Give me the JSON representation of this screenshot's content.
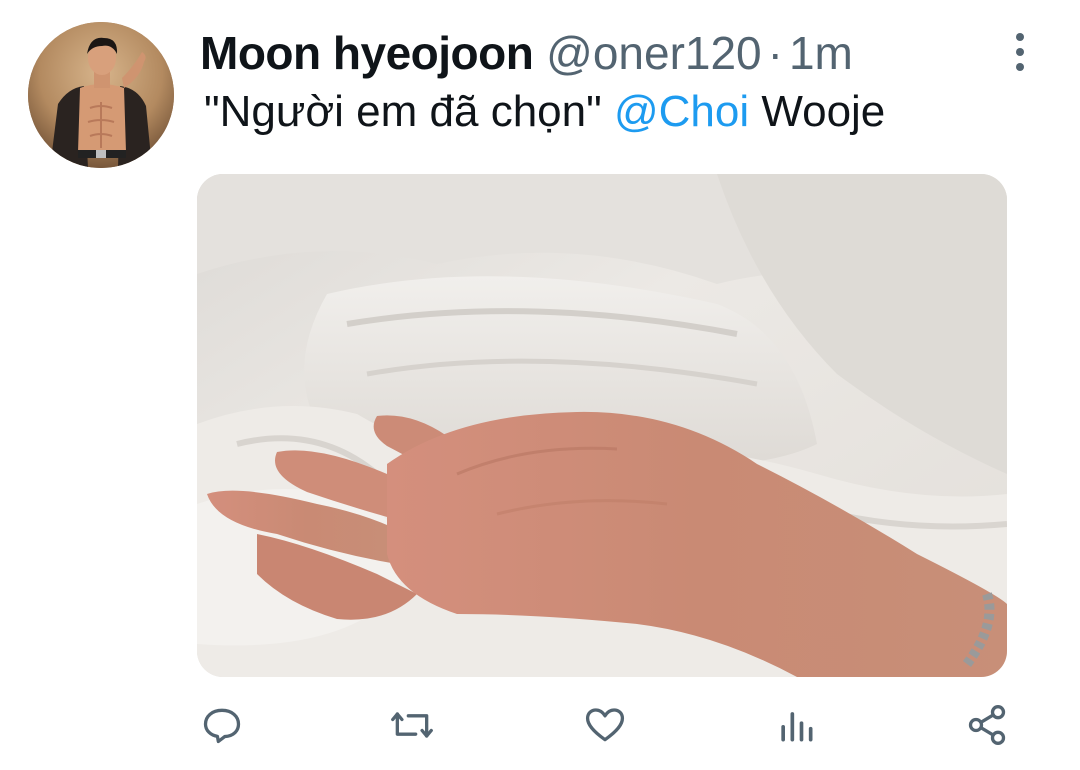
{
  "tweet": {
    "author": {
      "display_name": "Moon hyeojoon",
      "handle": "@oner120",
      "separator": "·",
      "time": "1m"
    },
    "text": {
      "quote": "\"Người em đã chọn\"",
      "mention": "@Choi",
      "rest": "Wooje"
    },
    "media": {
      "description_icon": "photo"
    },
    "actions": {
      "reply_icon": "reply-icon",
      "retweet_icon": "retweet-icon",
      "like_icon": "heart-icon",
      "analytics_icon": "analytics-icon",
      "share_icon": "share-icon"
    },
    "colors": {
      "mention": "#1d9bf0",
      "secondary_text": "#536471",
      "primary_text": "#0f1419"
    }
  }
}
